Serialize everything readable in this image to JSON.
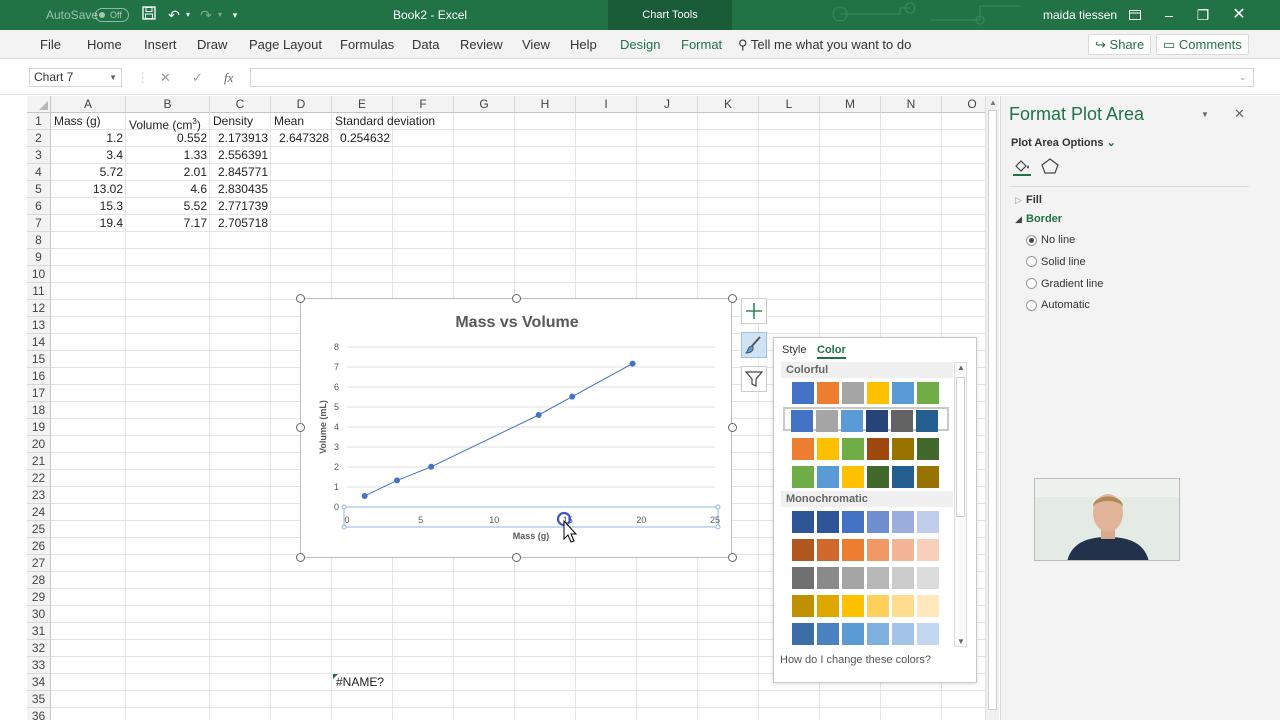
{
  "titlebar": {
    "autosave_label": "AutoSave",
    "autosave_state": "Off",
    "doc_title": "Book2  -  Excel",
    "contextual_label": "Chart Tools",
    "user": "maida tiessen",
    "bg_color": "#217346"
  },
  "ribbon": {
    "tabs": [
      "File",
      "Home",
      "Insert",
      "Draw",
      "Page Layout",
      "Formulas",
      "Data",
      "Review",
      "View",
      "Help",
      "Design",
      "Format"
    ],
    "tell_me": "Tell me what you want to do",
    "share": "Share",
    "comments": "Comments"
  },
  "formula_bar": {
    "name_box": "Chart 7",
    "fx": "fx",
    "value": ""
  },
  "sheet": {
    "columns": [
      "A",
      "B",
      "C",
      "D",
      "E",
      "F",
      "G",
      "H",
      "I",
      "J",
      "K",
      "L",
      "M",
      "N",
      "O"
    ],
    "rows": [
      "1",
      "2",
      "3",
      "4",
      "5",
      "6",
      "7",
      "8",
      "9",
      "10",
      "11",
      "12",
      "13",
      "14",
      "15",
      "16",
      "17",
      "18",
      "19",
      "20",
      "21",
      "22",
      "23",
      "24",
      "25",
      "26",
      "27",
      "28",
      "29",
      "30",
      "31",
      "32",
      "33",
      "34",
      "35",
      "36"
    ],
    "headers": {
      "a1": "Mass (g)",
      "b1": "Volume (cm",
      "b1_sup": "3",
      "b1_end": ")",
      "c1": "Density",
      "d1": "Mean",
      "e1": "Standard deviation"
    },
    "data_rows": [
      {
        "mass": "1.2",
        "volume": "0.552",
        "density": "2.173913"
      },
      {
        "mass": "3.4",
        "volume": "1.33",
        "density": "2.556391"
      },
      {
        "mass": "5.72",
        "volume": "2.01",
        "density": "2.845771"
      },
      {
        "mass": "13.02",
        "volume": "4.6",
        "density": "2.830435"
      },
      {
        "mass": "15.3",
        "volume": "5.52",
        "density": "2.771739"
      },
      {
        "mass": "19.4",
        "volume": "7.17",
        "density": "2.705718"
      }
    ],
    "mean": "2.647328",
    "stdev": "0.254632",
    "error_cell": "#NAME?"
  },
  "chart_data": {
    "type": "scatter",
    "title": "Mass vs Volume",
    "xlabel": "Mass (g)",
    "ylabel": "Volume (mL)",
    "xlim": [
      0,
      25
    ],
    "ylim": [
      0,
      8
    ],
    "xticks": [
      "0",
      "5",
      "10",
      "15",
      "20",
      "25"
    ],
    "yticks": [
      "0",
      "1",
      "2",
      "3",
      "4",
      "5",
      "6",
      "7",
      "8"
    ],
    "grid": true,
    "series": [
      {
        "x": [
          1.2,
          3.4,
          5.72,
          13.02,
          15.3,
          19.4
        ],
        "y": [
          0.552,
          1.33,
          2.01,
          4.6,
          5.52,
          7.17
        ],
        "color": "#4472c4"
      }
    ]
  },
  "style_popup": {
    "tab_style": "Style",
    "tab_color": "Color",
    "section_colorful": "Colorful",
    "section_mono": "Monochromatic",
    "help": "How do I change these colors?",
    "colorful": [
      [
        "#4472c4",
        "#ed7d31",
        "#a5a5a5",
        "#ffc000",
        "#5b9bd5",
        "#70ad47"
      ],
      [
        "#4472c4",
        "#a5a5a5",
        "#5b9bd5",
        "#264478",
        "#636363",
        "#255e91"
      ],
      [
        "#ed7d31",
        "#ffc000",
        "#70ad47",
        "#9e480e",
        "#997300",
        "#43682b"
      ],
      [
        "#70ad47",
        "#5b9bd5",
        "#ffc000",
        "#43682b",
        "#255e91",
        "#997300"
      ]
    ],
    "monochromatic": [
      [
        "#2f5597",
        "#2f5597",
        "#4472c4",
        "#6f8fd0",
        "#9caede",
        "#c1cdea"
      ],
      [
        "#b0561f",
        "#d0682b",
        "#ed7d31",
        "#f09966",
        "#f3b595",
        "#f7cfba"
      ],
      [
        "#707070",
        "#8a8a8a",
        "#a5a5a5",
        "#b8b8b8",
        "#cbcbcb",
        "#dcdcdc"
      ],
      [
        "#bf9000",
        "#dfa800",
        "#ffc000",
        "#ffd059",
        "#ffdc8f",
        "#ffe8bb"
      ],
      [
        "#3a6ea5",
        "#4a82c0",
        "#5b9bd5",
        "#7eb0df",
        "#a2c4e8",
        "#c3d8f0"
      ]
    ]
  },
  "format_pane": {
    "title": "Format Plot Area",
    "options": "Plot Area Options",
    "fill": "Fill",
    "border": "Border",
    "radios": [
      "No line",
      "Solid line",
      "Gradient line",
      "Automatic"
    ],
    "selected": "No line"
  }
}
